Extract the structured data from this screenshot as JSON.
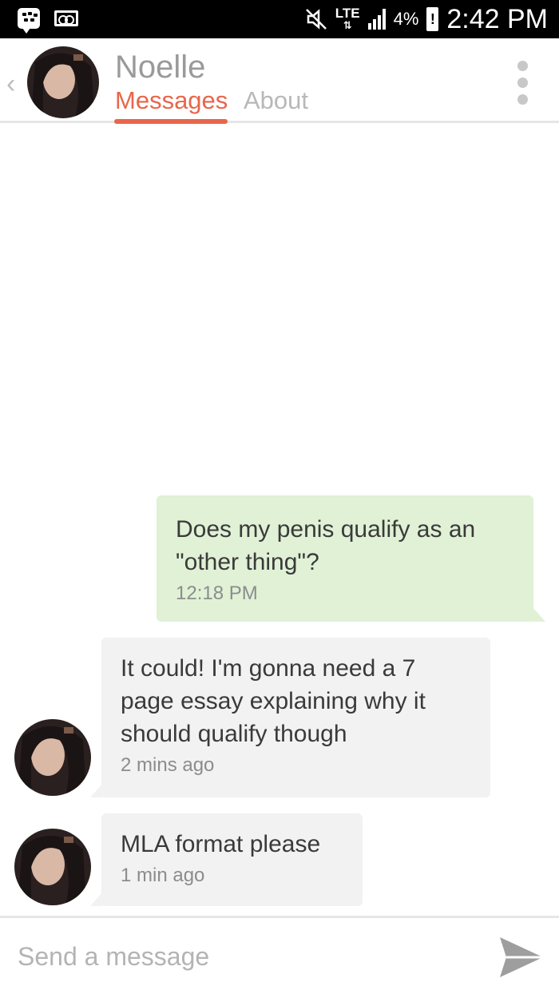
{
  "status_bar": {
    "network": "LTE",
    "battery_percent": "4%",
    "battery_alert": "!",
    "time": "2:42 PM",
    "icons": [
      "bbm-icon",
      "voicemail-icon",
      "mute-icon",
      "signal-icon",
      "battery-icon"
    ]
  },
  "header": {
    "name": "Noelle",
    "tabs": [
      {
        "label": "Messages",
        "active": true
      },
      {
        "label": "About",
        "active": false
      }
    ],
    "accent_color": "#e8664a"
  },
  "messages": [
    {
      "direction": "outgoing",
      "text": "Does my penis qualify as an \"other thing\"?",
      "time": "12:18 PM"
    },
    {
      "direction": "incoming",
      "text": "It could! I'm gonna need a 7 page essay explaining why it should qualify though",
      "time": "2 mins ago"
    },
    {
      "direction": "incoming",
      "text": "MLA format please",
      "time": "1 min ago"
    }
  ],
  "composer": {
    "placeholder": "Send a message",
    "value": ""
  },
  "colors": {
    "outgoing_bubble": "#e0f1d6",
    "incoming_bubble": "#f2f2f2"
  }
}
